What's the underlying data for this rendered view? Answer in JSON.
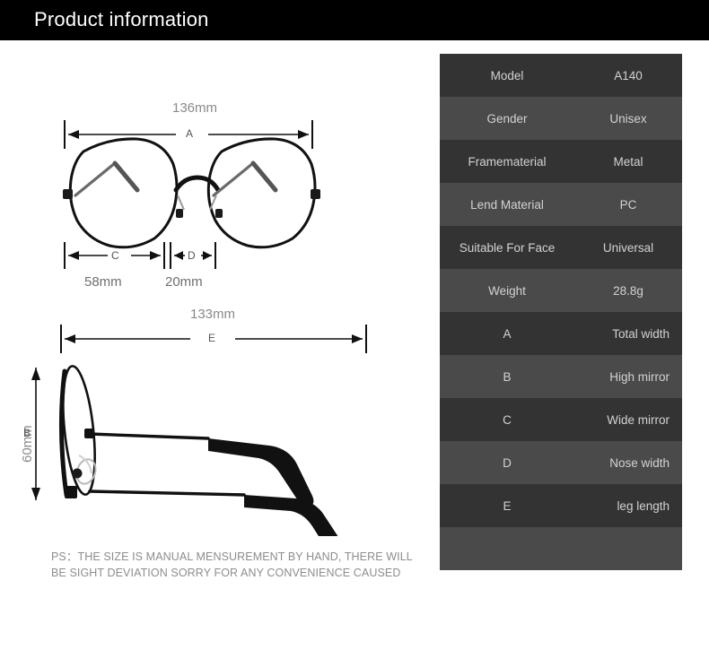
{
  "header": {
    "title": "Product information",
    "background": "#000000",
    "text_color": "#ffffff"
  },
  "spec_table": {
    "colors": {
      "row_dark": "#333333",
      "row_light": "#4a4a4a",
      "text": "#d2d2d2"
    },
    "rows": [
      {
        "label": "Model",
        "value": "A140"
      },
      {
        "label": "Gender",
        "value": "Unisex"
      },
      {
        "label": "Framematerial",
        "value": "Metal"
      },
      {
        "label": "Lend Material",
        "value": "PC"
      },
      {
        "label": "Suitable For Face",
        "value": "Universal"
      },
      {
        "label": "Weight",
        "value": "28.8g"
      },
      {
        "label": "A",
        "value": "Total width"
      },
      {
        "label": "B",
        "value": "High mirror"
      },
      {
        "label": "C",
        "value": "Wide mirror"
      },
      {
        "label": "D",
        "value": "Nose width"
      },
      {
        "label": "E",
        "value": "leg length"
      }
    ]
  },
  "front_view": {
    "total_width_value": "136mm",
    "total_width_letter": "A",
    "lens_width_value": "58mm",
    "lens_width_letter": "C",
    "bridge_width_value": "20mm",
    "bridge_width_letter": "D"
  },
  "side_view": {
    "leg_length_value": "133mm",
    "leg_length_letter": "E",
    "height_value": "60mm",
    "height_letter": "B"
  },
  "note": {
    "line1": "PS：THE SIZE IS MANUAL MENSUREMENT BY HAND, THERE WILL",
    "line2": "BE SIGHT DEVIATION SORRY FOR ANY CONVENIENCE CAUSED"
  }
}
